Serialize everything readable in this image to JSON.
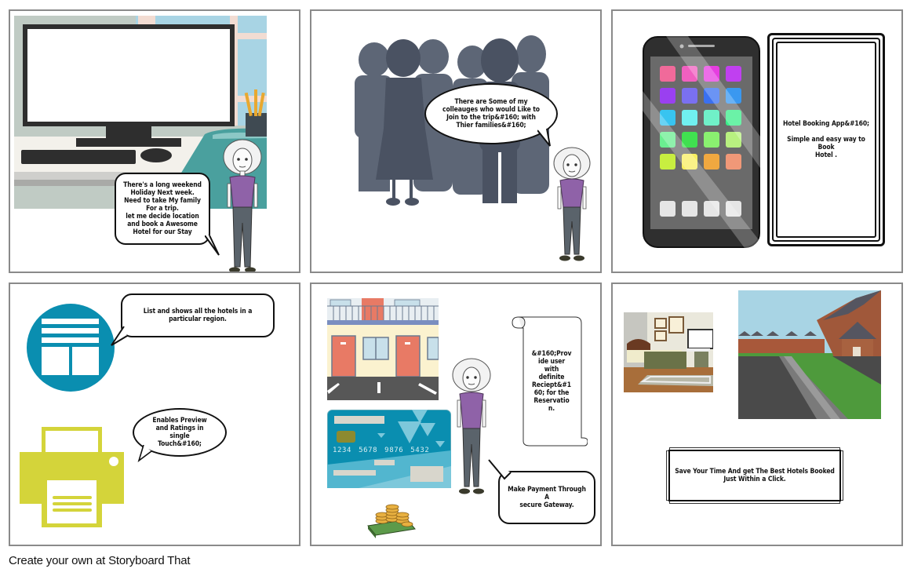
{
  "storyboard": {
    "panels": [
      {
        "id": 1,
        "scene": "office desk with computer monitor",
        "bubble_text": "There's a long weekend Holiday Next week. Need to take My family For a trip. let me decide location and book a Awesome Hotel for our Stay",
        "bubble_lines": [
          "There's a long weekend",
          "Holiday Next week.",
          "Need to take My family",
          "For a trip.",
          "let me decide location",
          "and book a Awesome",
          "Hotel for our Stay"
        ]
      },
      {
        "id": 2,
        "scene": "silhouettes of colleagues",
        "bubble_lines": [
          "There are Some of my",
          "colleauges who would Like to",
          "Join to the trip&#160; with",
          "Thier families&#160;"
        ]
      },
      {
        "id": 3,
        "scene": "smartphone with app grid",
        "caption_lines": [
          "Hotel Booking App&#160;",
          "",
          "Simple and easy way to Book",
          "Hotel ."
        ],
        "app_colors": [
          "#f06a9a",
          "#f060c0",
          "#e63ee0",
          "#c040f0",
          "#9a40f0",
          "#7a70f0",
          "#3a70f0",
          "#3a98f0",
          "#38c4f0",
          "#70f0f0",
          "#70f0c8",
          "#3aee8a",
          "#6aee90",
          "#40e050",
          "#8af070",
          "#b8f080",
          "#c8ee40",
          "#f8ee60",
          "#f0a840",
          "#f09878"
        ]
      },
      {
        "id": 4,
        "scene": "list icon and printer icon",
        "bubble1_lines": [
          "List and shows all the hotels in a",
          "particular region."
        ],
        "bubble2_lines": [
          "Enables Preview",
          "and Ratings in",
          "single",
          "Touch&#160;"
        ],
        "colors": {
          "list_icon": "#0a8eb0",
          "printer_icon": "#d4d43a"
        }
      },
      {
        "id": 5,
        "scene": "hotel, credit card, money",
        "scroll_lines": [
          "&#160;Prov",
          "ide user",
          "with",
          "definite",
          "Reciept&#1",
          "60; for the",
          "Reservatio",
          "n."
        ],
        "card_number": "1234 5678 9876 5432",
        "bubble_lines": [
          "Make Payment Through A",
          "secure Gateway."
        ]
      },
      {
        "id": 6,
        "scene": "bedroom and neighborhood street",
        "caption_lines": [
          "Save Your Time And get The Best Hotels Booked",
          "Just Within a Click."
        ]
      }
    ]
  },
  "footer": {
    "text": "Create your own at Storyboard That"
  }
}
